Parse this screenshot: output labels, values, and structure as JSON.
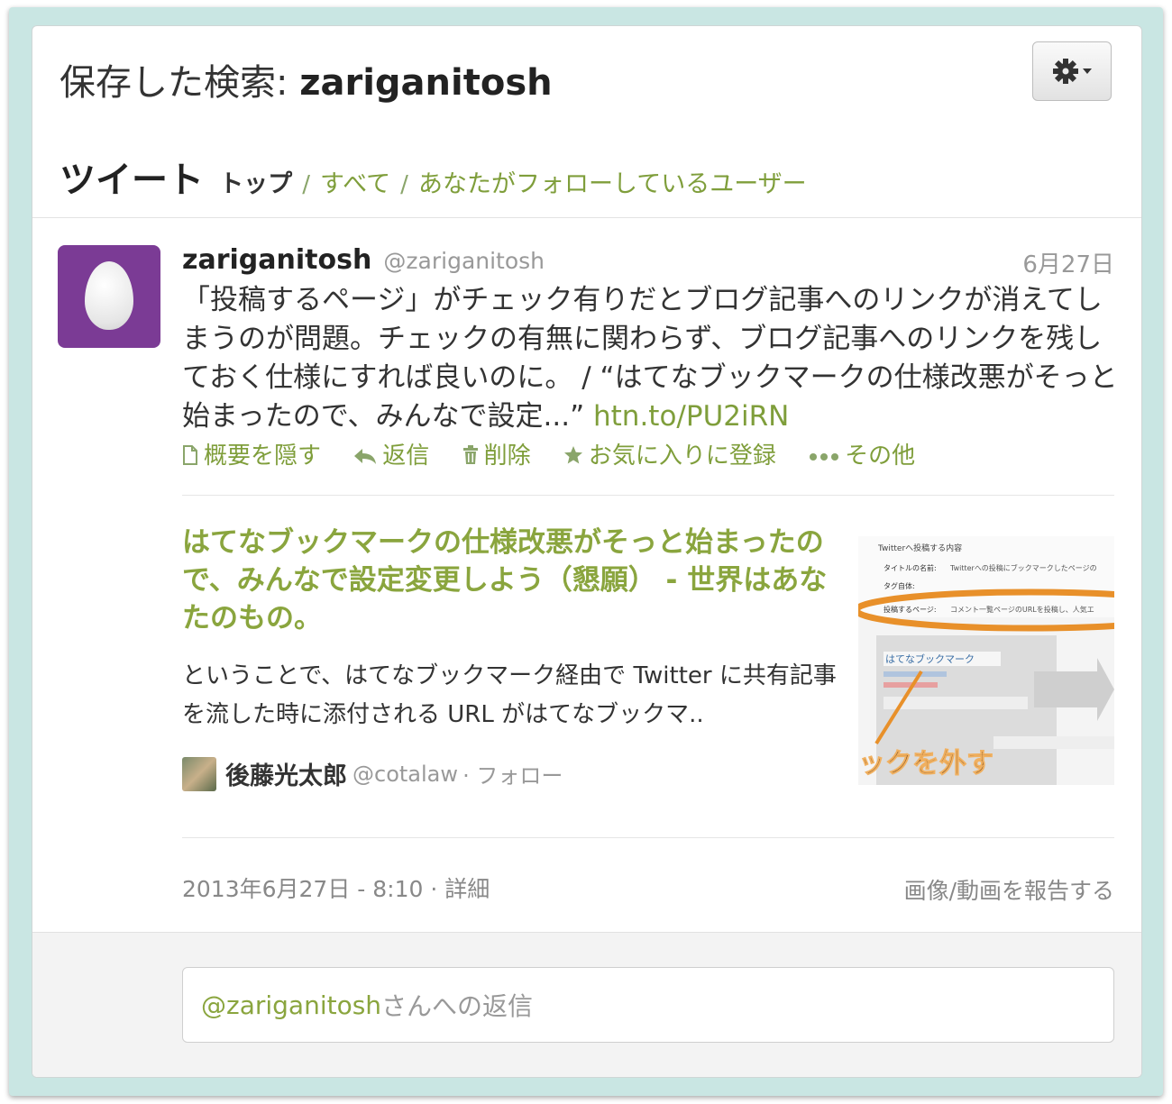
{
  "header": {
    "title_prefix": "保存した検索: ",
    "query": "zariganitosh",
    "settings_icon": "gear-icon"
  },
  "tabs": {
    "section": "ツイート",
    "active": "トップ",
    "separator": "/",
    "others": [
      "すべて",
      "あなたがフォローしているユーザー"
    ]
  },
  "tweet": {
    "display_name": "zariganitosh",
    "handle": "@zariganitosh",
    "date": "6月27日",
    "text": "「投稿するページ」がチェック有りだとブログ記事へのリンクが消えてしまうのが問題。チェックの有無に関わらず、ブログ記事へのリンクを残しておく仕様にすれば良いのに。 / “はてなブックマークの仕様改悪がそっと始まったので、みんなで設定...” ",
    "link": "htn.to/PU2iRN",
    "avatar_color": "#7b3b95",
    "actions": [
      {
        "icon": "document-icon",
        "label": "概要を隠す"
      },
      {
        "icon": "reply-icon",
        "label": "返信"
      },
      {
        "icon": "trash-icon",
        "label": "削除"
      },
      {
        "icon": "star-icon",
        "label": "お気に入りに登録"
      },
      {
        "icon": "more-icon",
        "label": "その他"
      }
    ]
  },
  "summary_card": {
    "title": "はてなブックマークの仕様改悪がそっと始まったので、みんなで設定変更しよう（懇願） - 世界はあなたのもの。",
    "description": "ということで、はてなブックマーク経由で Twitter に共有記事を流した時に添付される URL がはてなブックマ..",
    "author_name": "後藤光太郎",
    "author_handle": "@cotalaw",
    "follow_label": "· フォロー",
    "thumbnail": {
      "heading": "Twitterへ投稿する内容",
      "row1_label": "タイトルの名前:",
      "row1_text": "Twitterへの投稿にブックマークしたページの",
      "row2_label": "タグ自体:",
      "row3_label": "投稿するページ:",
      "row3_text": "コメント一覧ページのURLを投稿し、人気エ",
      "service_name": "はてなブックマーク",
      "overlay_text": "ックを外す",
      "arrow_icon": "arrow-right-icon"
    }
  },
  "meta": {
    "timestamp": "2013年6月27日 - 8:10 · 詳細",
    "report": "画像/動画を報告する"
  },
  "reply": {
    "mention": "@zariganitosh",
    "suffix": " さんへの返信"
  },
  "colors": {
    "accent_green": "#7f9e3b",
    "frame": "#c9e6e3",
    "avatar": "#7b3b95",
    "orange_highlight": "#e8902a"
  }
}
